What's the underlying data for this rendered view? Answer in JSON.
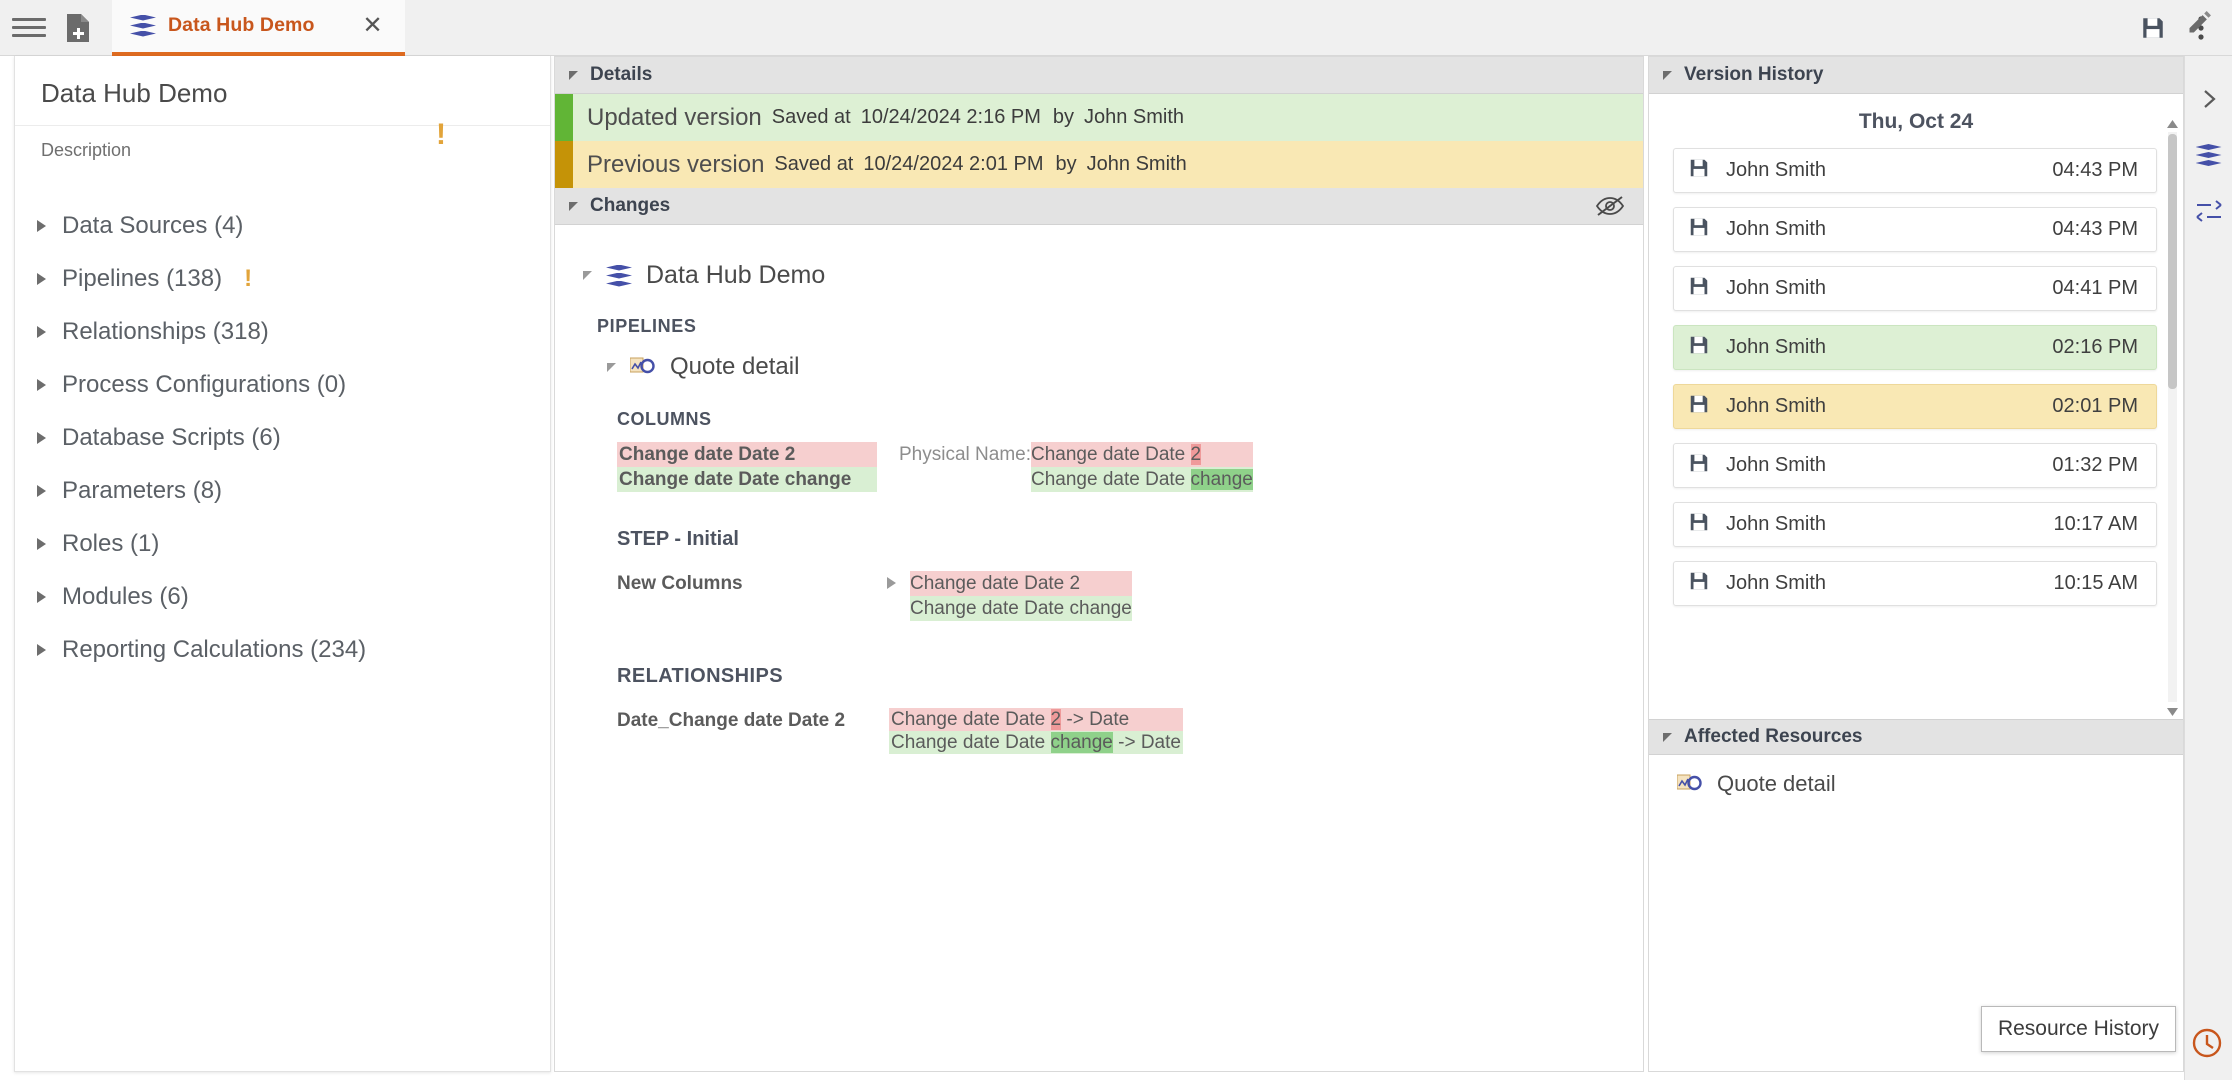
{
  "topbar": {
    "menu_icon": "hamburger-menu-icon",
    "new_doc_icon": "new-document-icon",
    "tab": {
      "title": "Data Hub Demo",
      "close_label": "✕",
      "logo_icon": "layers-icon"
    },
    "save_icon": "save-icon",
    "more_icon": "more-vertical-icon",
    "edit_icon": "pencil-icon"
  },
  "sidebar": {
    "title": "Data Hub Demo",
    "description_label": "Description",
    "warning_badge": "!",
    "items": [
      {
        "label": "Data Sources (4)",
        "warn": ""
      },
      {
        "label": "Pipelines (138)",
        "warn": "!"
      },
      {
        "label": "Relationships (318)",
        "warn": ""
      },
      {
        "label": "Process Configurations (0)",
        "warn": ""
      },
      {
        "label": "Database Scripts (6)",
        "warn": ""
      },
      {
        "label": "Parameters (8)",
        "warn": ""
      },
      {
        "label": "Roles (1)",
        "warn": ""
      },
      {
        "label": "Modules (6)",
        "warn": ""
      },
      {
        "label": "Reporting Calculations (234)",
        "warn": ""
      }
    ]
  },
  "details": {
    "header": "Details",
    "updated": {
      "name": "Updated version",
      "saved_at_label": "Saved at",
      "timestamp": "10/24/2024 2:16 PM",
      "by_label": "by",
      "user": "John Smith"
    },
    "previous": {
      "name": "Previous version",
      "saved_at_label": "Saved at",
      "timestamp": "10/24/2024 2:01 PM",
      "by_label": "by",
      "user": "John Smith"
    }
  },
  "changes": {
    "header": "Changes",
    "hide_icon": "eye-off-icon",
    "root": "Data Hub Demo",
    "pipelines_section": "PIPELINES",
    "pipeline_name": "Quote detail",
    "columns_section": "COLUMNS",
    "columns_diff": {
      "removed": "Change date Date 2",
      "added": "Change date Date change",
      "physical_name_label": "Physical Name:",
      "physical_removed_prefix": "Change date Date ",
      "physical_removed_hl": "2",
      "physical_added_prefix": "Change date Date ",
      "physical_added_hl": "change"
    },
    "step_section": "STEP - Initial",
    "new_columns_label": "New Columns",
    "new_columns_removed": "Change date Date 2",
    "new_columns_added": "Change date Date change",
    "relationships_section": "RELATIONSHIPS",
    "relationship_key": "Date_Change date Date 2",
    "relationship_removed_pre": "Change date Date ",
    "relationship_removed_hl": "2",
    "relationship_removed_post": " -> Date",
    "relationship_added_pre": "Change date Date ",
    "relationship_added_hl": "change",
    "relationship_added_post": " -> Date"
  },
  "version_history": {
    "header": "Version History",
    "day_label": "Thu, Oct 24",
    "save_icon": "save-icon",
    "entries": [
      {
        "user": "John Smith",
        "time": "04:43 PM",
        "state": ""
      },
      {
        "user": "John Smith",
        "time": "04:43 PM",
        "state": ""
      },
      {
        "user": "John Smith",
        "time": "04:41 PM",
        "state": ""
      },
      {
        "user": "John Smith",
        "time": "02:16 PM",
        "state": "green"
      },
      {
        "user": "John Smith",
        "time": "02:01 PM",
        "state": "yellow"
      },
      {
        "user": "John Smith",
        "time": "01:32 PM",
        "state": ""
      },
      {
        "user": "John Smith",
        "time": "10:17 AM",
        "state": ""
      },
      {
        "user": "John Smith",
        "time": "10:15 AM",
        "state": ""
      }
    ]
  },
  "affected_resources": {
    "header": "Affected Resources",
    "items": [
      {
        "name": "Quote detail"
      }
    ]
  },
  "rail": {
    "expand_icon": "chevron-right-icon",
    "layers_icon": "layers-icon",
    "relations_icon": "relations-icon",
    "history_icon": "history-clock-icon"
  },
  "tooltip": {
    "text": "Resource History"
  },
  "colors": {
    "accent": "#de6b20",
    "tab_title": "#c8561c",
    "added_bg": "#ddf0d4",
    "added_stripe": "#61b536",
    "removed_bg": "#f9e8b4",
    "removed_stripe": "#c59307",
    "diff_del": "#f6cfcf",
    "diff_add": "#d9efd3",
    "warn": "#e2a43a",
    "logo": "#4550a8"
  }
}
